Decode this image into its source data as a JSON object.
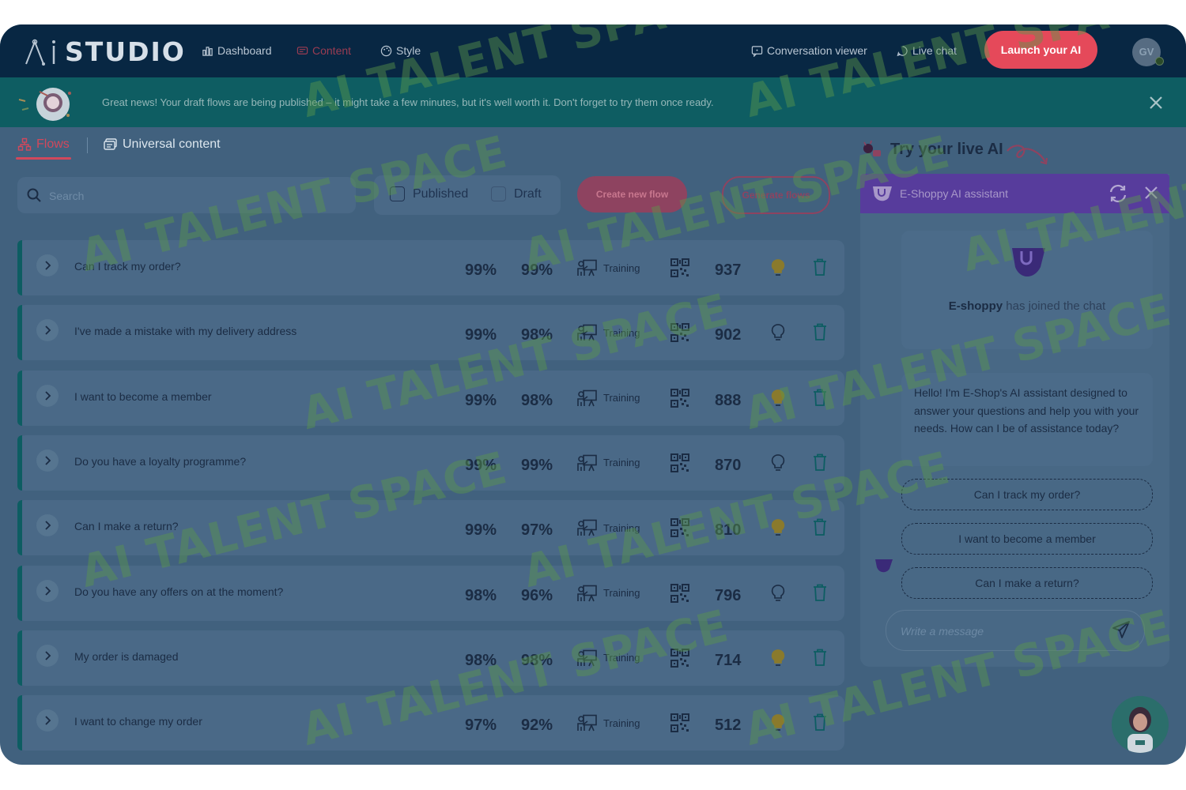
{
  "app": {
    "logo_text": "STUDIO"
  },
  "nav": {
    "items": [
      {
        "label": "Dashboard",
        "icon": "dashboard-icon"
      },
      {
        "label": "Content",
        "icon": "content-icon"
      },
      {
        "label": "Style",
        "icon": "palette-icon"
      }
    ],
    "right_items": [
      {
        "label": "Conversation viewer",
        "icon": "conversation-icon"
      },
      {
        "label": "Live chat",
        "icon": "live-chat-icon"
      }
    ],
    "launch_label": "Launch your AI",
    "user_initials": "GV"
  },
  "banner": {
    "text": "Great news! Your draft flows are being published – it might take a few minutes, but it's well worth it. Don't forget to try them once ready."
  },
  "tabs": [
    {
      "label": "Flows"
    },
    {
      "label": "Universal content"
    }
  ],
  "search": {
    "placeholder": "Search"
  },
  "filters": {
    "published_label": "Published",
    "draft_label": "Draft"
  },
  "actions": {
    "create_label": "Create new flow",
    "generate_label": "Generate flows"
  },
  "flows": [
    {
      "question": "Can I track my order?",
      "score1": "99%",
      "score2": "99%",
      "status": "Training",
      "count": "937",
      "bulb_on": true
    },
    {
      "question": "I've made a mistake with my delivery address",
      "score1": "99%",
      "score2": "98%",
      "status": "Training",
      "count": "902",
      "bulb_on": false
    },
    {
      "question": "I want to become a member",
      "score1": "99%",
      "score2": "98%",
      "status": "Training",
      "count": "888",
      "bulb_on": true
    },
    {
      "question": "Do you have a loyalty programme?",
      "score1": "99%",
      "score2": "99%",
      "status": "Training",
      "count": "870",
      "bulb_on": false
    },
    {
      "question": "Can I make a return?",
      "score1": "99%",
      "score2": "97%",
      "status": "Training",
      "count": "810",
      "bulb_on": true
    },
    {
      "question": "Do you have any offers on at the moment?",
      "score1": "98%",
      "score2": "96%",
      "status": "Training",
      "count": "796",
      "bulb_on": false
    },
    {
      "question": "My order is damaged",
      "score1": "98%",
      "score2": "98%",
      "status": "Training",
      "count": "714",
      "bulb_on": true
    },
    {
      "question": "I want to change my order",
      "score1": "97%",
      "score2": "92%",
      "status": "Training",
      "count": "512",
      "bulb_on": true
    }
  ],
  "try_panel": {
    "title": "Try your live AI"
  },
  "chat": {
    "title": "E-Shoppy AI assistant",
    "join_name": "E-shoppy",
    "join_text": "has joined the chat",
    "greeting": "Hello! I'm E-Shop's AI assistant designed to answer your questions and help you with your needs. How can I be of assistance today?",
    "suggestions": [
      "Can I track my order?",
      "I want to become a member",
      "Can I make a return?"
    ],
    "input_placeholder": "Write a message"
  },
  "watermark": "AI TALENT SPACE",
  "colors": {
    "brand": "#082743",
    "accent": "#e5495a",
    "banner": "#0e5d62",
    "chat_header": "#573c9c",
    "overlay": "#41617e"
  }
}
